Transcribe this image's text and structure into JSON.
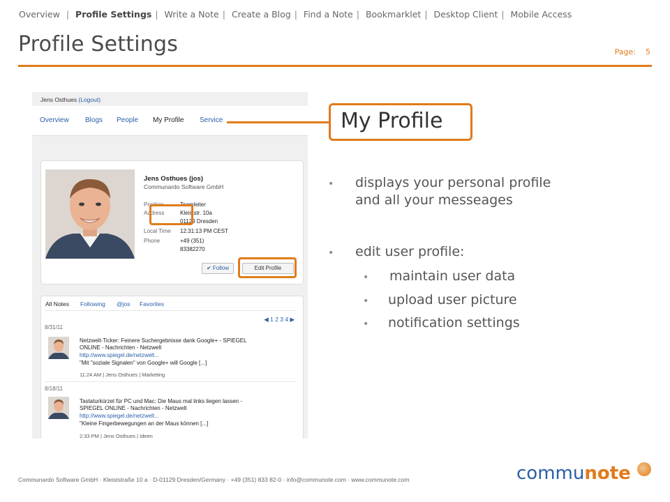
{
  "topnav": {
    "items": [
      "Overview",
      "Profile Settings",
      "Write a Note",
      "Create a Blog",
      "Find a Note",
      "Bookmarklet",
      "Desktop Client",
      "Mobile Access"
    ],
    "active": "Profile Settings"
  },
  "title": "Profile Settings",
  "page": {
    "label": "Page:",
    "number": "5"
  },
  "screenshot": {
    "user": "Jens Osthues",
    "logout": "(Logout)",
    "nav": [
      "Overview",
      "Blogs",
      "People",
      "My Profile",
      "Service"
    ],
    "profile": {
      "name": "Jens Osthues (jos)",
      "company": "Communardo Software GmbH",
      "position_label": "Position",
      "position": "Teamleiter",
      "address_label": "Address",
      "address1": "Kleiststr. 10a",
      "address2": "01129 Dresden",
      "localtime_label": "Local Time",
      "localtime": "12:31:13 PM CEST",
      "phone_label": "Phone",
      "phone1": "+49 (351)",
      "phone2": "83382270",
      "follow_btn": "✔ Follow",
      "edit_btn": "Edit Profile"
    },
    "tabs": [
      "All Notes",
      "Following",
      "@jos",
      "Favorites"
    ],
    "pager": "◀ 1 2 3 4 ▶",
    "notes": [
      {
        "date": "8/31/11",
        "line1": "Netzwelt-Ticker: Feinere Suchergebnisse dank Google+ - SPIEGEL",
        "line2": "ONLINE - Nachrichten - Netzwelt",
        "link": "http://www.spiegel.de/netzwelt...",
        "quote": "\"Mit \"soziale Signalen\" von Google+ will Google [...]",
        "meta": "11:24 AM  |  Jens Osthues  |  Marketing"
      },
      {
        "date": "8/18/11",
        "line1": "Tastaturkürzel für PC und Mac: Die Maus mal links liegen lassen -",
        "line2": "SPIEGEL ONLINE - Nachrichten - Netzwelt",
        "link": "http://www.spiegel.de/netzwelt...",
        "quote": "\"Kleine Fingerbewegungen an der Maus können [...]",
        "meta": "2:33 PM  |  Jens Osthues  |  Ideen"
      }
    ]
  },
  "callout": "My Profile",
  "bullets": {
    "b1_line1": "displays your personal profile",
    "b1_line2": "and all your messeages",
    "b2": "edit user profile:",
    "sub": [
      "maintain user data",
      "upload user picture",
      "notification settings"
    ]
  },
  "footer": "Communardo Software GmbH · Kleiststraße 10 a  ·  D-01129 Dresden/Germany  ·  +49 (351) 833 82-0  ·  info@communote.com  ·  www.communote.com",
  "logo": {
    "part1": "commu",
    "part2": "note"
  },
  "colors": {
    "accent": "#e07b1a",
    "link": "#2a5fa8"
  }
}
